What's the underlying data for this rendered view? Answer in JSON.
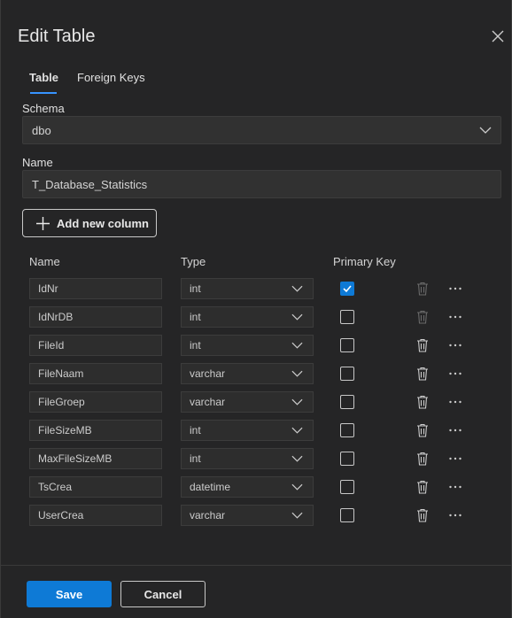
{
  "dialog": {
    "title": "Edit Table"
  },
  "tabs": [
    {
      "label": "Table",
      "active": true
    },
    {
      "label": "Foreign Keys",
      "active": false
    }
  ],
  "schema": {
    "label": "Schema",
    "value": "dbo"
  },
  "name": {
    "label": "Name",
    "value": "T_Database_Statistics"
  },
  "add_column_label": "Add new column",
  "columns_header": {
    "name": "Name",
    "type": "Type",
    "primary_key": "Primary Key"
  },
  "rows": [
    {
      "name": "IdNr",
      "type": "int",
      "primary_key": true
    },
    {
      "name": "IdNrDB",
      "type": "int",
      "primary_key": false
    },
    {
      "name": "FileId",
      "type": "int",
      "primary_key": false
    },
    {
      "name": "FileNaam",
      "type": "varchar",
      "primary_key": false
    },
    {
      "name": "FileGroep",
      "type": "varchar",
      "primary_key": false
    },
    {
      "name": "FileSizeMB",
      "type": "int",
      "primary_key": false
    },
    {
      "name": "MaxFileSizeMB",
      "type": "int",
      "primary_key": false
    },
    {
      "name": "TsCrea",
      "type": "datetime",
      "primary_key": false
    },
    {
      "name": "UserCrea",
      "type": "varchar",
      "primary_key": false
    }
  ],
  "footer": {
    "save_label": "Save",
    "cancel_label": "Cancel"
  },
  "colors": {
    "accent": "#0e7ad6",
    "background": "#252526",
    "input_bg": "#313131"
  }
}
